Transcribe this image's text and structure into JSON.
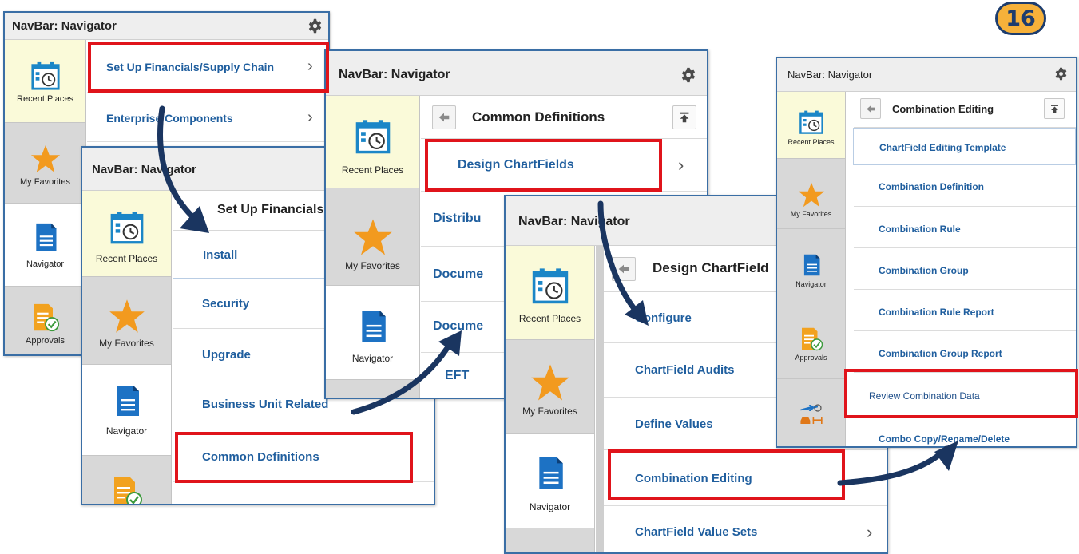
{
  "step_number": "16",
  "colors": {
    "accent_blue": "#1f5e9e",
    "highlight_red": "#e0141b",
    "arrow_navy": "#1a3560",
    "badge_orange": "#f6b13a"
  },
  "panels": [
    {
      "title": "NavBar: Navigator",
      "sidebar": [
        "Recent Places",
        "My Favorites",
        "Navigator",
        "Approvals"
      ],
      "items": [
        "Set Up Financials/Supply Chain",
        "Enterprise Components"
      ]
    },
    {
      "title": "NavBar: Navigator",
      "sidebar": [
        "Recent Places",
        "My Favorites",
        "Navigator"
      ],
      "subheader": "Set Up Financials",
      "items": [
        "Install",
        "Security",
        "Upgrade",
        "Business Unit Related",
        "Common Definitions"
      ]
    },
    {
      "title": "NavBar: Navigator",
      "sidebar": [
        "Recent Places",
        "My Favorites",
        "Navigator"
      ],
      "subheader": "Common Definitions",
      "items": [
        "Design ChartFields",
        "Distribu",
        "Docume",
        "Docume",
        "EFT"
      ]
    },
    {
      "title": "NavBar: Navigator",
      "sidebar": [
        "Recent Places",
        "My Favorites",
        "Navigator"
      ],
      "subheader": "Design ChartField",
      "items": [
        "Configure",
        "ChartField Audits",
        "Define Values",
        "Combination Editing",
        "ChartField Value Sets"
      ]
    },
    {
      "title": "NavBar: Navigator",
      "sidebar": [
        "Recent Places",
        "My Favorites",
        "Navigator",
        "Approvals"
      ],
      "subheader": "Combination Editing",
      "items": [
        "ChartField Editing Template",
        "Combination Definition",
        "Combination Rule",
        "Combination Group",
        "Combination Rule Report",
        "Combination Group Report",
        "Review Combination Data",
        "Combo Copy/Rename/Delete"
      ]
    }
  ]
}
